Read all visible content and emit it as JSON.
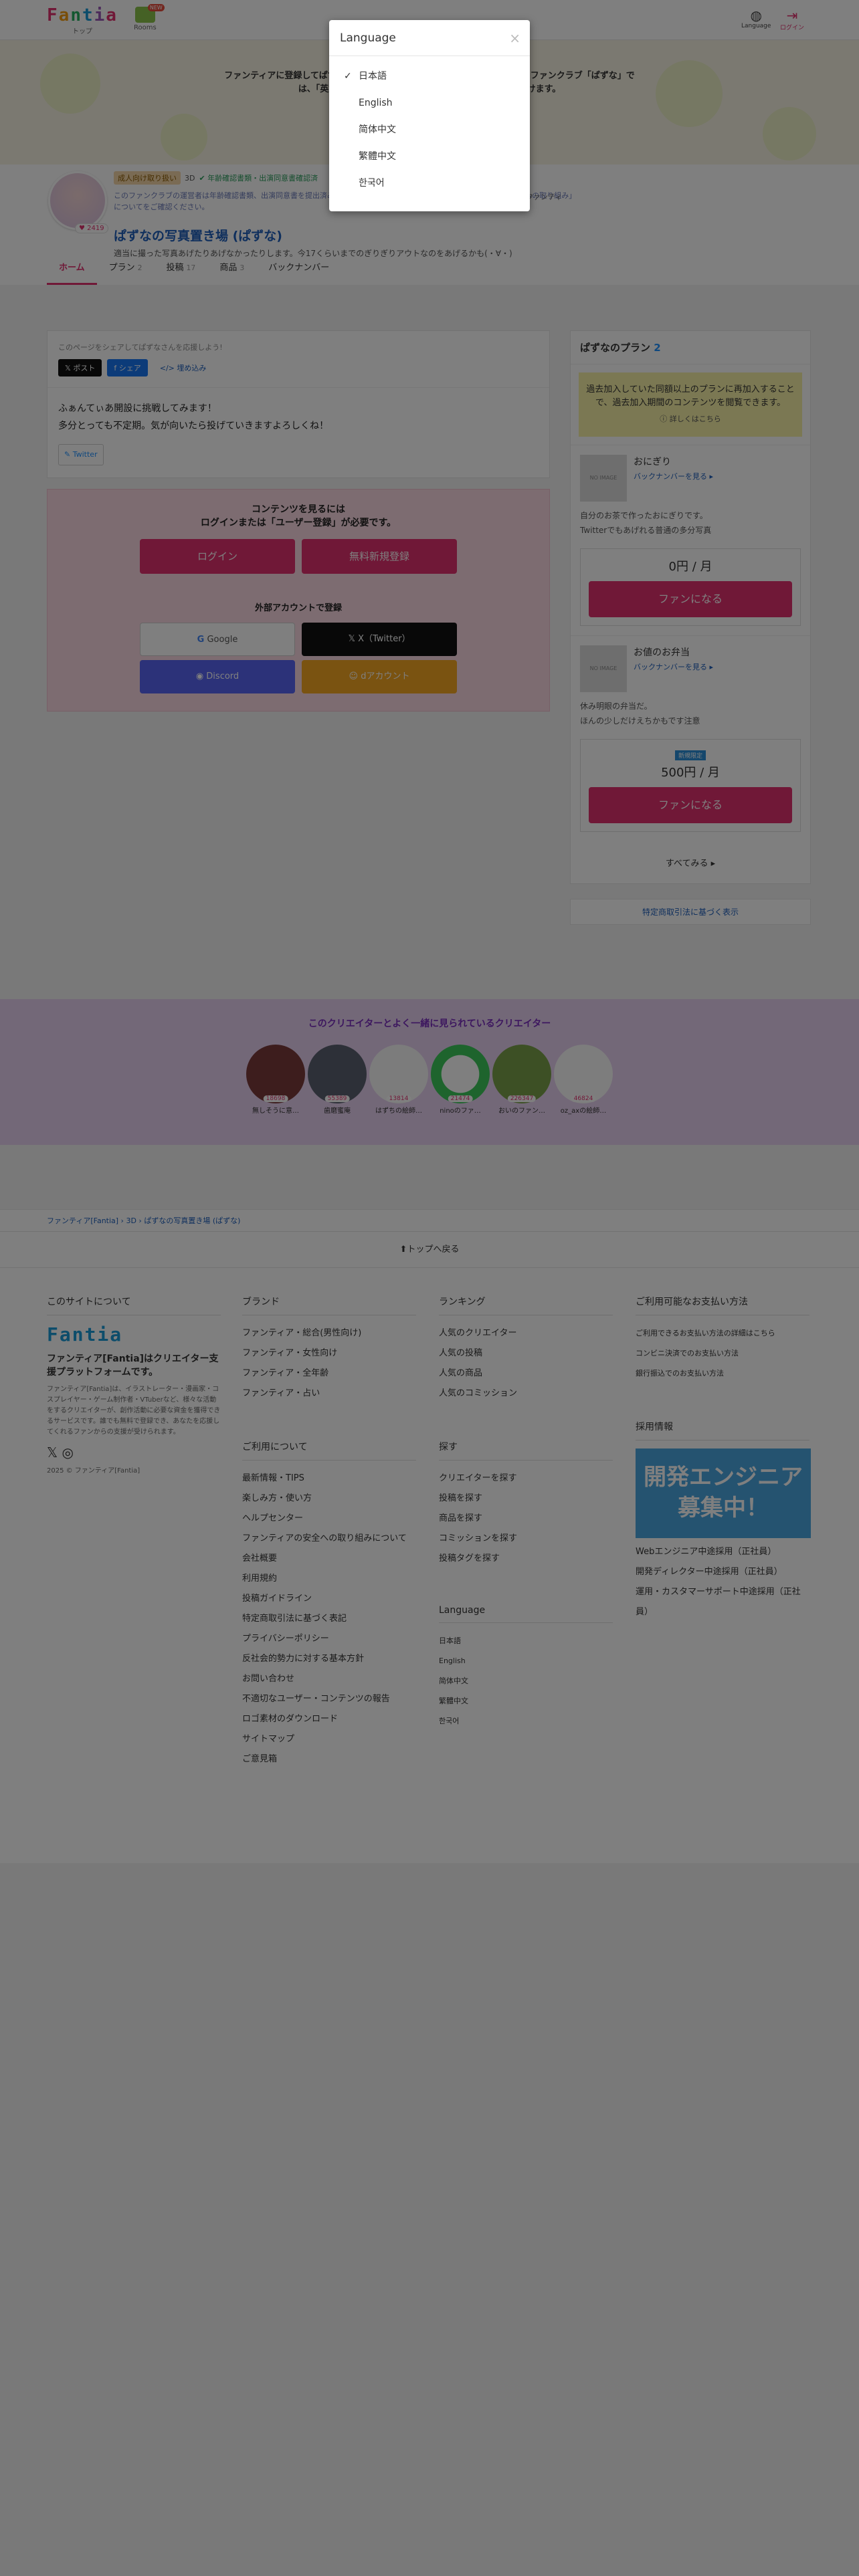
{
  "header": {
    "logo": "Fantia",
    "logo_sub": "トップ",
    "rooms_label": "Rooms",
    "rooms_new": "NEW",
    "language_label": "Language",
    "login_label": "ログイン"
  },
  "banner": {
    "line1": "ファンティアに登録してぱずなさんを応援しよう！ 登録すると、ぱずなさんのファンクラブ「ぱずな」で",
    "line2": "は、「英女聖で認識で…（閉じ）」 こともにアクセスいただけます。"
  },
  "profile": {
    "fan_count": "2419",
    "tag_adult": "成人向け取り扱い",
    "tag_3d": "3D",
    "tag_verified": "年齢確認書類・出演同意書確認済",
    "intro": "このファンクラブの運営者は年齢確認書類、出演同意書を提出済みです。詳しくは、ファンティアの「違法な性的コンテンツへの取り組み」についてをご確認ください。",
    "intro_btn": "ファンティ",
    "title": "ぱずなの写真置き場 (ぱずな)",
    "description": "適当に撮った写真あげたりあげなかったりします。今17くらいまでのぎりぎりアウトなのをあげるかも(・∀・)"
  },
  "tabs": [
    {
      "label": "ホーム",
      "count": ""
    },
    {
      "label": "プラン",
      "count": "2"
    },
    {
      "label": "投稿",
      "count": "17"
    },
    {
      "label": "商品",
      "count": "3"
    },
    {
      "label": "バックナンバー",
      "count": ""
    }
  ],
  "share": {
    "hint": "このページをシェアしてぱずなさんを応援しよう!",
    "post_x": "ポスト",
    "share_fb": "シェア",
    "embed": "埋め込み"
  },
  "post": {
    "line1": "ふぁんてぃあ開設に挑戦してみます！",
    "line2": "多分とっても不定期。気が向いたら投げていきますよろしくね！",
    "twitter": "Twitter"
  },
  "login": {
    "title1": "コンテンツを見るには",
    "title2": "ログインまたは「ユーザー登録」が必要です。",
    "login_btn": "ログイン",
    "signup_btn": "無料新規登録",
    "external": "外部アカウントで登録",
    "google": "Google",
    "x": "X（Twitter）",
    "discord": "Discord",
    "other": "dアカウント"
  },
  "side": {
    "title": "ぱずなのプラン",
    "count": "2",
    "notice": "過去加入していた同額以上のプランに再加入することで、過去加入期間のコンテンツを閲覧できます。",
    "notice_more": "詳しくはこちら",
    "plans": [
      {
        "name": "おにぎり",
        "back": "バックナンバーを見る",
        "desc1": "自分のお茶で作ったおにぎりです。",
        "desc2": "Twitterでもあげれる普通の多分写真",
        "label": "",
        "price": "0円 / 月",
        "btn": "ファンになる"
      },
      {
        "name": "お値のお弁当",
        "back": "バックナンバーを見る",
        "desc1": "休み明眼の弁当だ。",
        "desc2": "ほんの少しだけえちかもです注意",
        "label": "新規限定",
        "price": "500円 / 月",
        "btn": "ファンになる"
      }
    ],
    "see_all": "すべてみる",
    "law": "特定商取引法に基づく表示",
    "noimage": "NO IMAGE"
  },
  "together": {
    "title": "このクリエイターとよく一緒に見られているクリエイター",
    "creators": [
      {
        "name": "無しそうに意…",
        "count": "18698"
      },
      {
        "name": "歯磨蜜庵",
        "count": "55389"
      },
      {
        "name": "はずちの絵師…",
        "count": "13814"
      },
      {
        "name": "ninoのファ…",
        "count": "21474"
      },
      {
        "name": "おいのファン…",
        "count": "226347"
      },
      {
        "name": "oz_axの絵師…",
        "count": "46824"
      }
    ]
  },
  "breadcrumb": [
    "ファンティア[Fantia]",
    "3D",
    "ぱずなの写真置き場 (ぱずな)"
  ],
  "totop": "トップへ戻る",
  "footer": {
    "about_h": "このサイトについて",
    "about_title": "ファンティア[Fantia]はクリエイター支援プラットフォームです。",
    "about_desc": "ファンティア[Fantia]は、イラストレーター・漫画家・コスプレイヤー・ゲーム制作者・VTuberなど、様々な活動をするクリエイターが、創作活動に必要な資金を獲得できるサービスです。誰でも無料で登録でき、あなたを応援してくれるファンからの支援が受けられます。",
    "copyright": "2025 © ファンティア[Fantia]",
    "brand_h": "ブランド",
    "brand": [
      "ファンティア・総合(男性向け)",
      "ファンティア・女性向け",
      "ファンティア・全年齢",
      "ファンティア・占い"
    ],
    "usage_h": "ご利用について",
    "usage": [
      "最新情報・TIPS",
      "楽しみ方・使い方",
      "ヘルプセンター",
      "ファンティアの安全への取り組みについて",
      "会社概要",
      "利用規約",
      "投稿ガイドライン",
      "特定商取引法に基づく表記",
      "プライバシーポリシー",
      "反社会的勢力に対する基本方針",
      "お問い合わせ",
      "不適切なユーザー・コンテンツの報告",
      "ロゴ素材のダウンロード",
      "サイトマップ",
      "ご意見箱"
    ],
    "ranking_h": "ランキング",
    "ranking": [
      "人気のクリエイター",
      "人気の投稿",
      "人気の商品",
      "人気のコミッション"
    ],
    "search_h": "探す",
    "search": [
      "クリエイターを探す",
      "投稿を探す",
      "商品を探す",
      "コミッションを探す",
      "投稿タグを探す"
    ],
    "lang_h": "Language",
    "langs": [
      "日本語",
      "English",
      "简体中文",
      "繁體中文",
      "한국어"
    ],
    "pay_h": "ご利用可能なお支払い方法",
    "pay": [
      "ご利用できるお支払い方法の詳細はこちら",
      "コンビニ決済でのお支払い方法",
      "銀行振込でのお支払い方法"
    ],
    "recruit_h": "採用情報",
    "recruit_img": "開発エンジニア募集中！",
    "recruit": [
      "Webエンジニア中途採用（正社員）",
      "開発ディレクター中途採用（正社員）",
      "運用・カスタマーサポート中途採用（正社員）"
    ]
  },
  "modal": {
    "title": "Language",
    "close": "×",
    "check": "✓",
    "options": [
      "日本語",
      "English",
      "简体中文",
      "繁體中文",
      "한국어"
    ],
    "selected": "日本語"
  }
}
